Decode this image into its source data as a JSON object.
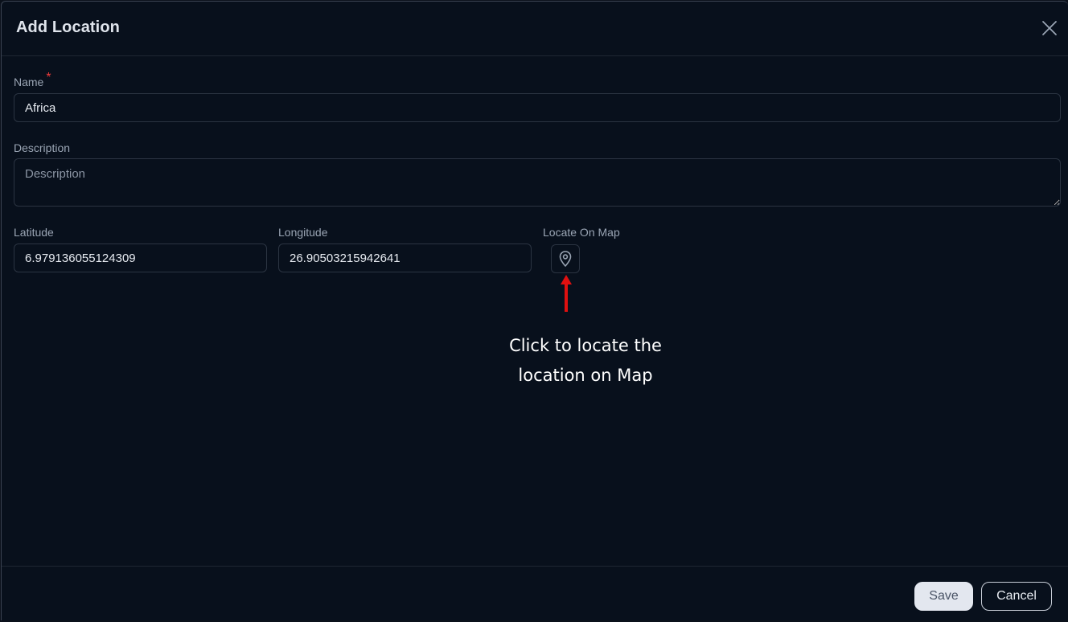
{
  "dialog": {
    "title": "Add Location",
    "close_icon": "close-icon"
  },
  "form": {
    "name": {
      "label": "Name",
      "required_mark": "*",
      "value": "Africa"
    },
    "description": {
      "label": "Description",
      "value": "",
      "placeholder": "Description"
    },
    "latitude": {
      "label": "Latitude",
      "value": "6.979136055124309"
    },
    "longitude": {
      "label": "Longitude",
      "value": "26.90503215942641"
    },
    "locate_on_map": {
      "label": "Locate On Map",
      "icon": "map-pin-icon"
    }
  },
  "annotation": {
    "line1": "Click to locate the",
    "line2": "location on Map",
    "arrow_color": "#e01010"
  },
  "footer": {
    "save_label": "Save",
    "cancel_label": "Cancel"
  },
  "colors": {
    "background": "#08101c",
    "border": "#2b3442",
    "required": "#ef3b3b"
  }
}
